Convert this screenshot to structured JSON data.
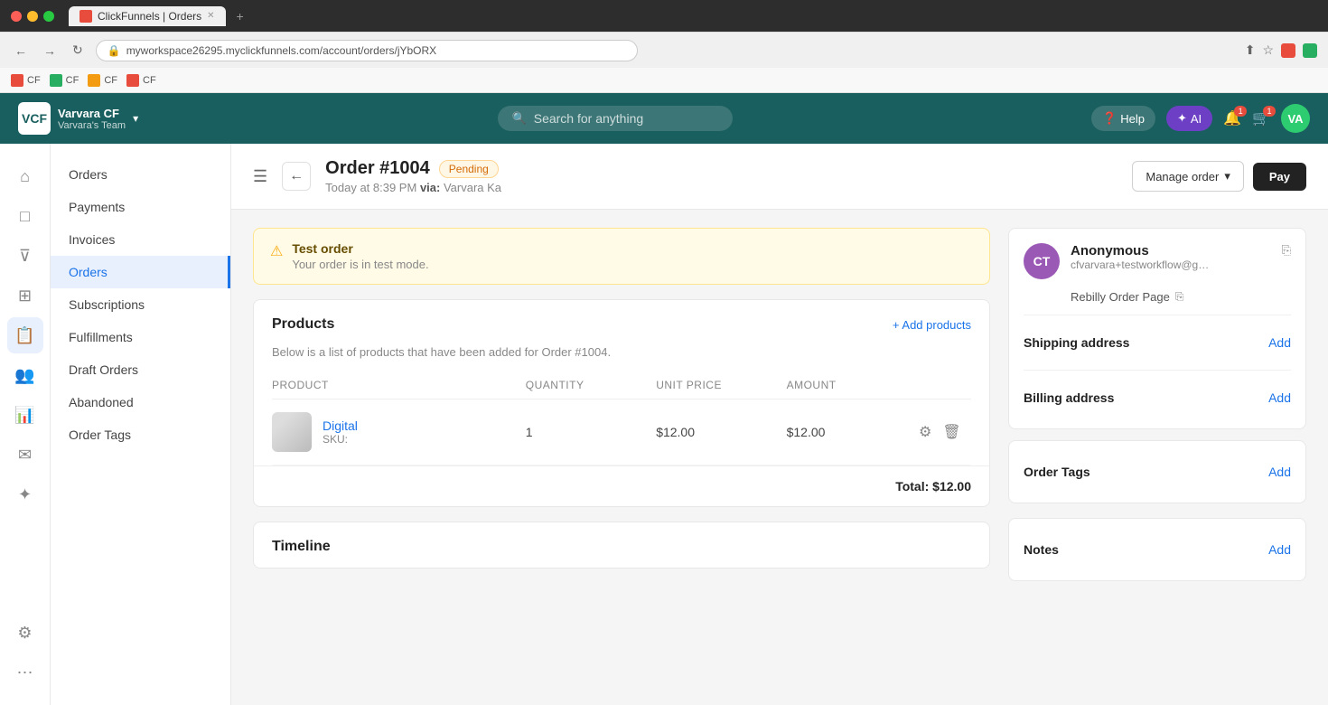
{
  "browser": {
    "tab_title": "ClickFunnels | Orders",
    "tab_favicon": "CF",
    "url": "myworkspace26295.myclickfunnels.com/account/orders/jYbORX",
    "new_tab_label": "+"
  },
  "bookmarks": [
    {
      "label": "CF",
      "icon_color": "#e74c3c"
    },
    {
      "label": "CF",
      "icon_color": "#27ae60"
    },
    {
      "label": "CF",
      "icon_color": "#f39c12"
    },
    {
      "label": "CF",
      "icon_color": "#e74c3c"
    }
  ],
  "topnav": {
    "logo_text": "VCF",
    "workspace_name": "Varvara CF",
    "workspace_team": "Varvara's Team",
    "dropdown_label": "▾",
    "search_placeholder": "Search for anything",
    "help_label": "Help",
    "ai_label": "AI",
    "avatar_initials": "VA",
    "notification_badge": "1",
    "cart_badge": "1"
  },
  "sidebar": {
    "icons": [
      {
        "name": "home-icon",
        "symbol": "⌂",
        "active": false
      },
      {
        "name": "store-icon",
        "symbol": "□",
        "active": false
      },
      {
        "name": "funnel-icon",
        "symbol": "⊽",
        "active": false
      },
      {
        "name": "products-icon",
        "symbol": "⊞",
        "active": false
      },
      {
        "name": "orders-icon",
        "symbol": "📋",
        "active": true
      },
      {
        "name": "contacts-icon",
        "symbol": "👥",
        "active": false
      },
      {
        "name": "analytics-icon",
        "symbol": "📊",
        "active": false
      },
      {
        "name": "email-icon",
        "symbol": "✉",
        "active": false
      },
      {
        "name": "affiliates-icon",
        "symbol": "✦",
        "active": false
      },
      {
        "name": "settings-icon",
        "symbol": "⚙",
        "active": false
      },
      {
        "name": "ai2-icon",
        "symbol": "⋯",
        "active": false
      }
    ]
  },
  "nav_panel": {
    "items": [
      {
        "label": "Orders",
        "active": false
      },
      {
        "label": "Payments",
        "active": false
      },
      {
        "label": "Invoices",
        "active": false
      },
      {
        "label": "Orders",
        "active": true
      },
      {
        "label": "Subscriptions",
        "active": false
      },
      {
        "label": "Fulfillments",
        "active": false
      },
      {
        "label": "Draft Orders",
        "active": false
      },
      {
        "label": "Abandoned",
        "active": false
      },
      {
        "label": "Order Tags",
        "active": false
      }
    ]
  },
  "page_header": {
    "order_number": "Order #1004",
    "status": "Pending",
    "order_meta": "Today at 8:39 PM",
    "via_label": "via:",
    "via_value": "Varvara Ka",
    "manage_label": "Manage order",
    "pay_label": "Pay"
  },
  "warning": {
    "title": "Test order",
    "message": "Your order is in test mode."
  },
  "products_card": {
    "title": "Products",
    "subtitle": "Below is a list of products that have been added for Order #1004.",
    "add_button": "+ Add products",
    "table_headers": [
      "Product",
      "Quantity",
      "Unit Price",
      "Amount"
    ],
    "rows": [
      {
        "name": "Digital",
        "sku": "SKU:",
        "quantity": "1",
        "unit_price": "$12.00",
        "amount": "$12.00"
      }
    ],
    "total_label": "Total:",
    "total_value": "$12.00"
  },
  "timeline_card": {
    "title": "Timeline"
  },
  "customer_card": {
    "avatar_initials": "CT",
    "avatar_color": "#9b59b6",
    "name": "Anonymous",
    "email": "cfvarvara+testworkflow@gmai...",
    "source": "Rebilly Order Page"
  },
  "shipping_section": {
    "label": "Shipping address",
    "add_label": "Add"
  },
  "billing_section": {
    "label": "Billing address",
    "add_label": "Add"
  },
  "order_tags_section": {
    "label": "Order Tags",
    "add_label": "Add"
  },
  "notes_section": {
    "label": "Notes",
    "add_label": "Add"
  }
}
